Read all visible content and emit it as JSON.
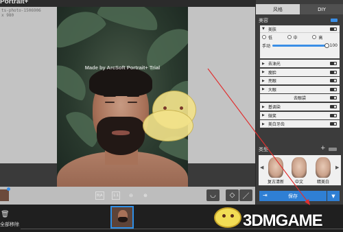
{
  "app": {
    "title": "Portrait+",
    "file_info_line1": "ts-photo-1506906",
    "file_info_line2": "x 980"
  },
  "canvas": {
    "watermark": "Made by ArcSoft Portrait+ Trial",
    "toolbar": {
      "compare_label": "B|A",
      "fit_label": "1:1"
    }
  },
  "panel": {
    "tabs": [
      "风格",
      "DIY"
    ],
    "active_tab": 1,
    "beauty_header": "美容",
    "skin": {
      "label": "美肤",
      "options": [
        "低",
        "中",
        "高"
      ],
      "selected_option": null,
      "manual_label": "手动",
      "manual_value": "100",
      "manual_fraction": 1.0
    },
    "features": [
      "去油光",
      "瘦脸",
      "亮眼",
      "大眼",
      "去眼袋",
      "基调染",
      "微笑",
      "美白牙齿"
    ],
    "styles_header": "类型",
    "styles": [
      "复古清新",
      "中文",
      "精美白"
    ],
    "save_label": "保存"
  },
  "filmstrip": {
    "remove_label": "全部移除"
  },
  "brand": {
    "logo_text": "3DMGAME"
  },
  "colors": {
    "accent": "#2f7fd4",
    "panel_bg": "#3c3c3c",
    "annotation_arrow": "#e03030"
  },
  "icons": {
    "zoom_out": "zoom-out-icon",
    "zoom_in": "zoom-in-icon",
    "trash": "trash-icon",
    "eraser": "eraser-icon",
    "brush": "brush-icon"
  }
}
